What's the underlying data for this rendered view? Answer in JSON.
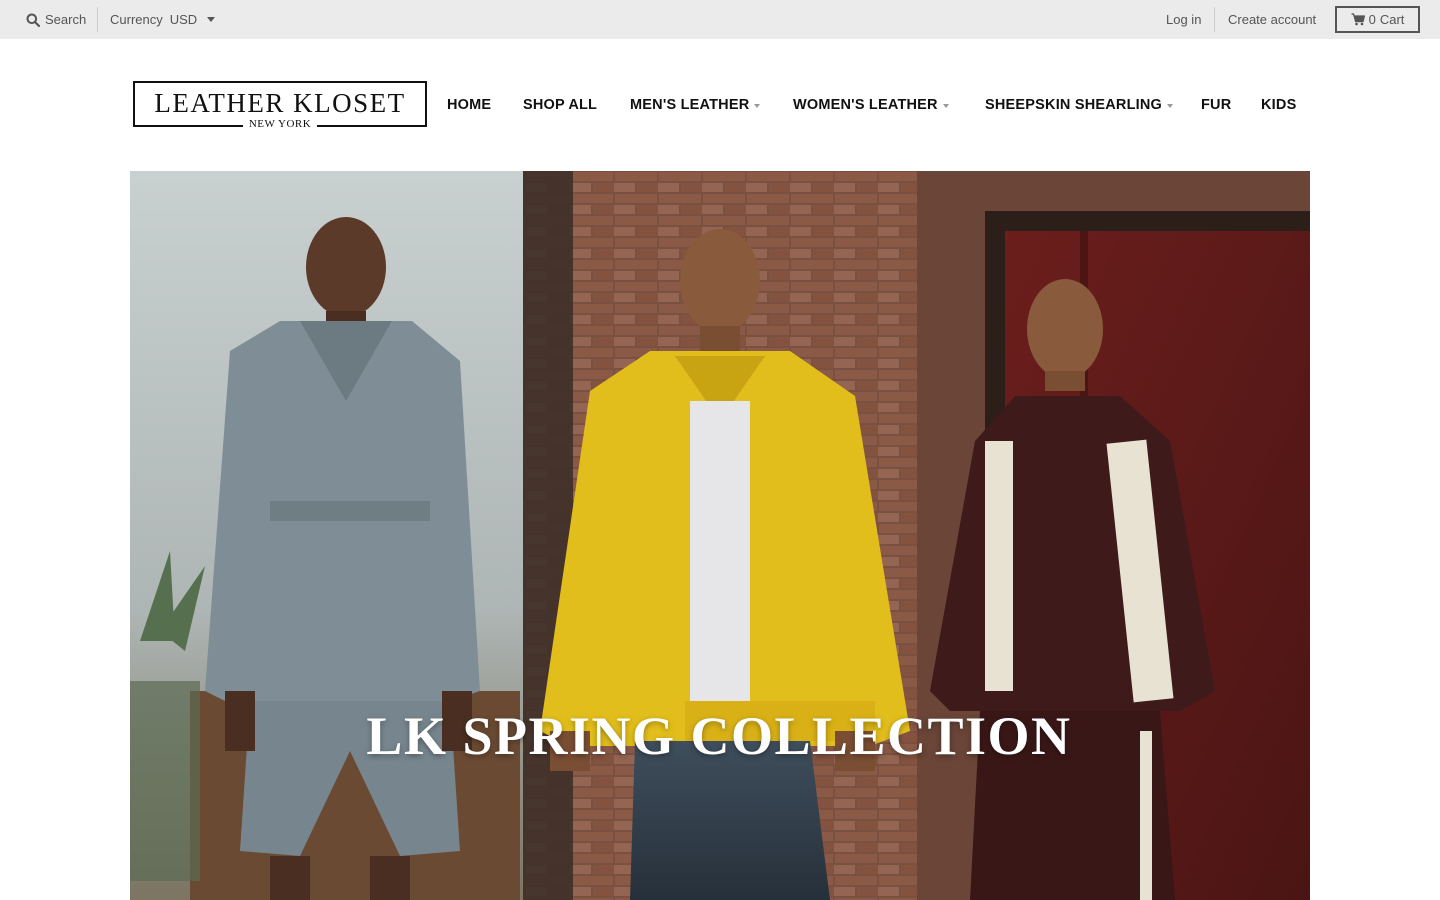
{
  "topbar": {
    "search_label": "Search",
    "currency_label": "Currency",
    "currency_value": "USD",
    "login_label": "Log in",
    "create_account_label": "Create account",
    "cart_count": "0",
    "cart_label": "Cart"
  },
  "header": {
    "logo_name": "LEATHER KLOSET",
    "logo_sub": "NEW YORK"
  },
  "nav": {
    "items": [
      {
        "label": "HOME"
      },
      {
        "label": "SHOP ALL"
      },
      {
        "label": "MEN'S LEATHER"
      },
      {
        "label": "WOMEN'S LEATHER"
      },
      {
        "label": "SHEEPSKIN SHEARLING"
      },
      {
        "label": "FUR"
      },
      {
        "label": "KIDS"
      }
    ]
  },
  "hero": {
    "title": "LK SPRING COLLECTION"
  },
  "colors": {
    "topbar_bg": "#ebebeb",
    "text_dark": "#111111",
    "jacket_grey": "#7f8e96",
    "jacket_yellow": "#e2be1c",
    "jacket_burgundy": "#3e1a1a",
    "jacket_cream": "#e7e2d2"
  }
}
